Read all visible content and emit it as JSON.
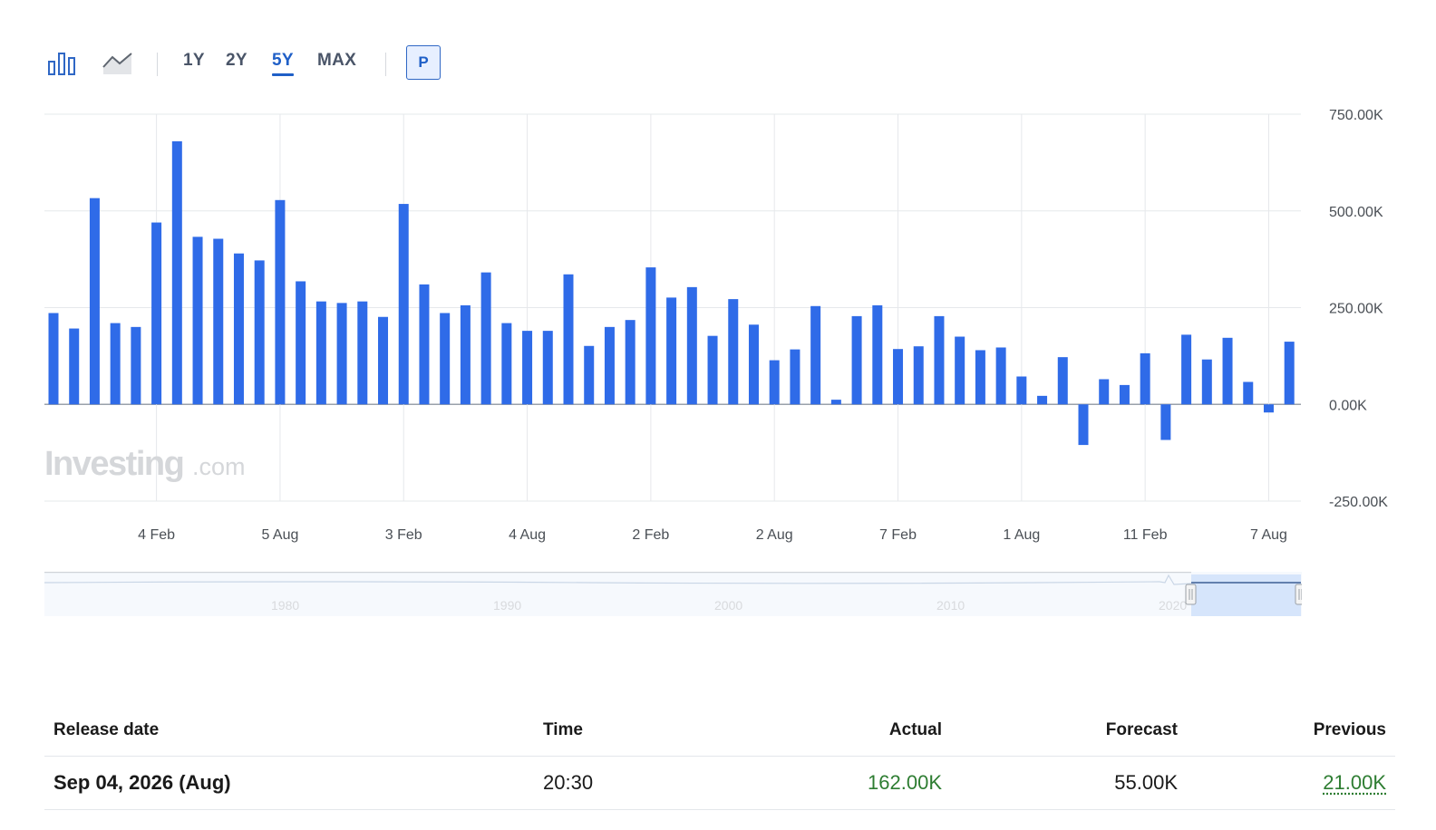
{
  "toolbar": {
    "chart_type_icons": [
      "bar-chart-icon",
      "area-chart-icon"
    ],
    "ranges": [
      "1Y",
      "2Y",
      "5Y",
      "MAX"
    ],
    "active_range": "5Y",
    "p_button": "P"
  },
  "watermark": {
    "brand": "Investing",
    "suffix": ".com"
  },
  "navigator": {
    "year_labels": [
      "1980",
      "1990",
      "2000",
      "2010",
      "2020"
    ]
  },
  "colors": {
    "bar": "#2f6be8",
    "accent": "#1f5fc7",
    "positive": "#2e7d32"
  },
  "chart_data": {
    "type": "bar",
    "title": "",
    "xlabel": "",
    "ylabel": "",
    "ylim": [
      -250000,
      750000
    ],
    "y_ticks": [
      "750.00K",
      "500.00K",
      "250.00K",
      "0.00K",
      "-250.00K"
    ],
    "y_tick_values": [
      750000,
      500000,
      250000,
      0,
      -250000
    ],
    "x_tick_labels": [
      "4 Feb",
      "5 Aug",
      "3 Feb",
      "4 Aug",
      "2 Feb",
      "2 Aug",
      "7 Feb",
      "1 Aug",
      "11 Feb",
      "7 Aug"
    ],
    "x_tick_bar_index": [
      5,
      11,
      17,
      23,
      29,
      35,
      41,
      47,
      53,
      59
    ],
    "grid": true,
    "values": [
      236000,
      196000,
      533000,
      210000,
      200000,
      470000,
      680000,
      433000,
      428000,
      390000,
      372000,
      528000,
      318000,
      266000,
      262000,
      266000,
      226000,
      518000,
      310000,
      236000,
      256000,
      341000,
      210000,
      190000,
      190000,
      336000,
      151000,
      200000,
      218000,
      354000,
      276000,
      303000,
      177000,
      272000,
      206000,
      114000,
      142000,
      254000,
      12000,
      228000,
      256000,
      143000,
      150000,
      228000,
      175000,
      140000,
      147000,
      72000,
      22000,
      122000,
      -105000,
      65000,
      50000,
      132000,
      -92000,
      180000,
      116000,
      172000,
      58000,
      -21000,
      162000
    ]
  },
  "table": {
    "headers": {
      "release_date": "Release date",
      "time": "Time",
      "actual": "Actual",
      "forecast": "Forecast",
      "previous": "Previous"
    },
    "rows": [
      {
        "release_date": "Sep 04, 2026 (Aug)",
        "time": "20:30",
        "actual": "162.00K",
        "forecast": "55.00K",
        "previous": "21.00K"
      }
    ]
  }
}
